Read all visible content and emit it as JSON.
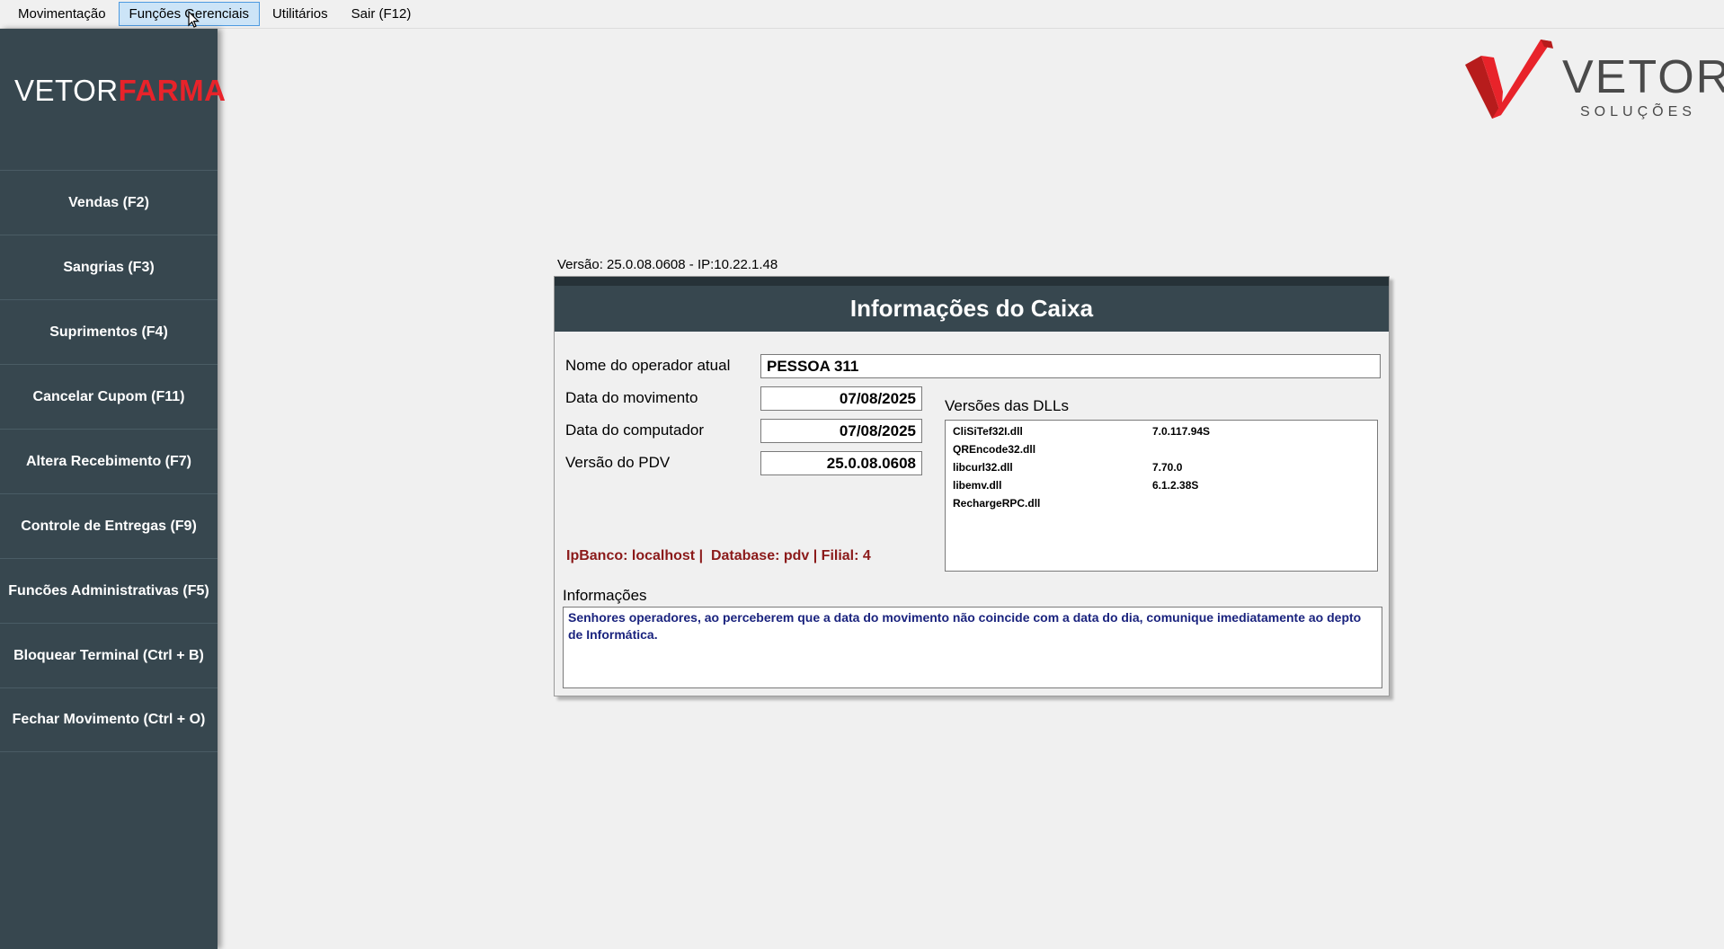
{
  "menubar": {
    "items": [
      {
        "label": "Movimentação",
        "active": false
      },
      {
        "label": "Funções Gerenciais",
        "active": true
      },
      {
        "label": "Utilitários",
        "active": false
      },
      {
        "label": "Sair (F12)",
        "active": false
      }
    ]
  },
  "sidebar": {
    "logo_part1": "VETOR",
    "logo_part2": "FARMA",
    "items": [
      {
        "label": "Vendas (F2)"
      },
      {
        "label": "Sangrias (F3)"
      },
      {
        "label": "Suprimentos (F4)"
      },
      {
        "label": "Cancelar Cupom (F11)"
      },
      {
        "label": "Altera Recebimento (F7)"
      },
      {
        "label": "Controle de Entregas (F9)"
      },
      {
        "label": "Funcões Administrativas (F5)"
      },
      {
        "label": "Bloquear Terminal (Ctrl + B)"
      },
      {
        "label": "Fechar Movimento (Ctrl + O)"
      }
    ]
  },
  "brand": {
    "word": "VETOR",
    "sub": "SOLUÇÕES",
    "colors": {
      "red": "#e8232a",
      "dark_red": "#b71c1c",
      "gray": "#4a4a4a"
    }
  },
  "version_line": "Versão: 25.0.08.0608 - IP:10.22.1.48",
  "panel": {
    "title": "Informações do Caixa",
    "operator_label": "Nome do operador atual",
    "operator_value": "PESSOA 311",
    "mov_date_label": "Data do movimento",
    "mov_date_value": "07/08/2025",
    "pc_date_label": "Data do computador",
    "pc_date_value": "07/08/2025",
    "pdv_version_label": "Versão do PDV",
    "pdv_version_value": "25.0.08.0608",
    "dll_title": "Versões das DLLs",
    "dlls": [
      {
        "name": "CliSiTef32I.dll",
        "version": "7.0.117.94S"
      },
      {
        "name": "QREncode32.dll",
        "version": ""
      },
      {
        "name": "libcurl32.dll",
        "version": "7.70.0"
      },
      {
        "name": "libemv.dll",
        "version": "6.1.2.38S"
      },
      {
        "name": "RechargeRPC.dll",
        "version": ""
      }
    ],
    "connection_info": "IpBanco: localhost |  Database: pdv | Filial: 4",
    "info_title": "Informações",
    "info_text": "Senhores operadores, ao perceberem que a data do movimento não coincide com a data do dia,  comunique imediatamente ao depto de Informática."
  },
  "colors": {
    "sidebar_bg": "#37474f",
    "header_bg": "#37474f",
    "info_text": "#1a237e",
    "connection_text": "#8b1a1a",
    "menu_active_bg": "#cce4f7"
  }
}
